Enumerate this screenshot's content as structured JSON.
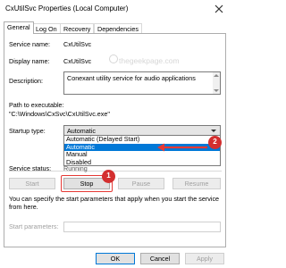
{
  "window": {
    "title": "CxUtilSvc Properties (Local Computer)"
  },
  "tabs": [
    "General",
    "Log On",
    "Recovery",
    "Dependencies"
  ],
  "general": {
    "service_name_label": "Service name:",
    "service_name_value": "CxUtilSvc",
    "display_name_label": "Display name:",
    "display_name_value": "CxUtilSvc",
    "description_label": "Description:",
    "description_value": "Conexant utility service for audio applications",
    "path_label": "Path to executable:",
    "path_value": "\"C:\\Windows\\CxSvc\\CxUtilSvc.exe\"",
    "startup_type_label": "Startup type:",
    "startup_type_value": "Automatic",
    "startup_options": [
      "Automatic (Delayed Start)",
      "Automatic",
      "Manual",
      "Disabled"
    ],
    "startup_selected_index": 1,
    "service_status_label": "Service status:",
    "service_status_value": "Running",
    "buttons": {
      "start": "Start",
      "stop": "Stop",
      "pause": "Pause",
      "resume": "Resume"
    },
    "help_text": "You can specify the start parameters that apply when you start the service from here.",
    "start_params_label": "Start parameters:",
    "start_params_value": ""
  },
  "dialog_buttons": {
    "ok": "OK",
    "cancel": "Cancel",
    "apply": "Apply"
  },
  "annotations": {
    "badge1": "1",
    "badge2": "2",
    "watermark": "thegeekpage.com"
  },
  "colors": {
    "accent": "#0078d7",
    "annotation_red": "#e53935"
  }
}
